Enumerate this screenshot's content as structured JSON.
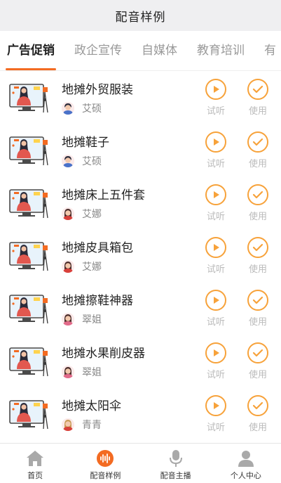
{
  "header": {
    "title": "配音样例"
  },
  "tabs": [
    {
      "label": "广告促销",
      "active": true
    },
    {
      "label": "政企宣传",
      "active": false
    },
    {
      "label": "自媒体",
      "active": false
    },
    {
      "label": "教育培训",
      "active": false
    },
    {
      "label": "有",
      "active": false
    }
  ],
  "actions": {
    "listen": "试听",
    "use": "使用"
  },
  "items": [
    {
      "name": "地摊外贸服装",
      "author": "艾硕",
      "avatar": "male"
    },
    {
      "name": "地摊鞋子",
      "author": "艾硕",
      "avatar": "male"
    },
    {
      "name": "地摊床上五件套",
      "author": "艾娜",
      "avatar": "female-dark"
    },
    {
      "name": "地摊皮具箱包",
      "author": "艾娜",
      "avatar": "female-dark"
    },
    {
      "name": "地摊擦鞋神器",
      "author": "翠姐",
      "avatar": "female-pink"
    },
    {
      "name": "地摊水果削皮器",
      "author": "翠姐",
      "avatar": "female-pink"
    },
    {
      "name": "地摊太阳伞",
      "author": "青青",
      "avatar": "female-light"
    }
  ],
  "bottom_nav": [
    {
      "label": "首页",
      "icon": "home-icon",
      "active": false
    },
    {
      "label": "配音样例",
      "icon": "soundwave-icon",
      "active": true
    },
    {
      "label": "配音主播",
      "icon": "microphone-icon",
      "active": false
    },
    {
      "label": "个人中心",
      "icon": "person-icon",
      "active": false
    }
  ],
  "colors": {
    "accent": "#f36b22",
    "action": "#f7a23a",
    "muted": "#bbbbbb",
    "nav_icon": "#a9a9a9"
  }
}
